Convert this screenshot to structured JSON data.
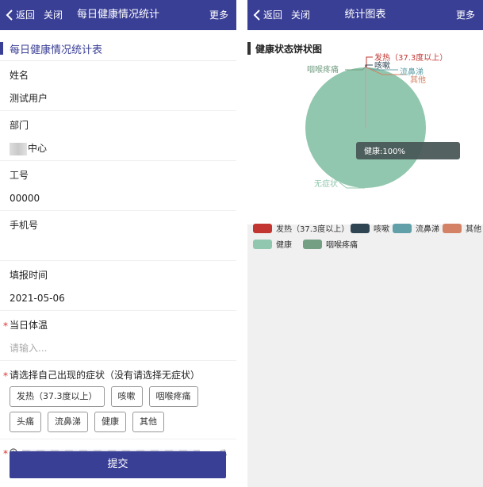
{
  "left": {
    "topbar": {
      "back_label": "返回",
      "close_label": "关闭",
      "title": "每日健康情况统计",
      "more_label": "更多"
    },
    "section_title": "每日健康情况统计表",
    "fields": {
      "name": {
        "label": "姓名",
        "value": "测试用户"
      },
      "dept": {
        "label": "部门",
        "value": "中心"
      },
      "empno": {
        "label": "工号",
        "value": "00000"
      },
      "phone": {
        "label": "手机号",
        "value": ""
      },
      "time": {
        "label": "填报时间",
        "value": "2021-05-06"
      },
      "temp": {
        "label": "当日体温",
        "placeholder": "请输入..."
      },
      "symptoms": {
        "label": "请选择自己出现的症状（没有请选择无症状）",
        "options": [
          "发热（37.3度以上）",
          "咳嗽",
          "咽喉疼痛",
          "头痛",
          "流鼻涕",
          "健康",
          "其他"
        ]
      }
    },
    "required_mark": "*",
    "submit_label": "提交"
  },
  "right": {
    "topbar": {
      "back_label": "返回",
      "close_label": "关闭",
      "title": "统计图表",
      "more_label": "更多"
    },
    "chart_title": "健康状态饼状图",
    "tooltip": "健康:100%",
    "callouts": {
      "fever": "发热（37.3度以上）",
      "cough": "咳嗽",
      "runny": "流鼻涕",
      "other": "其他",
      "throat": "咽喉疼痛",
      "none": "无症状"
    },
    "legend": [
      {
        "name": "发热（37.3度以上）",
        "color": "#c23531"
      },
      {
        "name": "咳嗽",
        "color": "#2f4554"
      },
      {
        "name": "流鼻涕",
        "color": "#61a0a8"
      },
      {
        "name": "其他",
        "color": "#d48265"
      },
      {
        "name": "健康",
        "color": "#91c7ae"
      },
      {
        "name": "咽喉疼痛",
        "color": "#749f83"
      }
    ]
  },
  "chart_data": {
    "type": "pie",
    "title": "健康状态饼状图",
    "categories": [
      "发热（37.3度以上）",
      "咳嗽",
      "流鼻涕",
      "其他",
      "健康",
      "咽喉疼痛",
      "无症状"
    ],
    "values": [
      0,
      0,
      0,
      0,
      100,
      0,
      0
    ],
    "unit": "%"
  }
}
